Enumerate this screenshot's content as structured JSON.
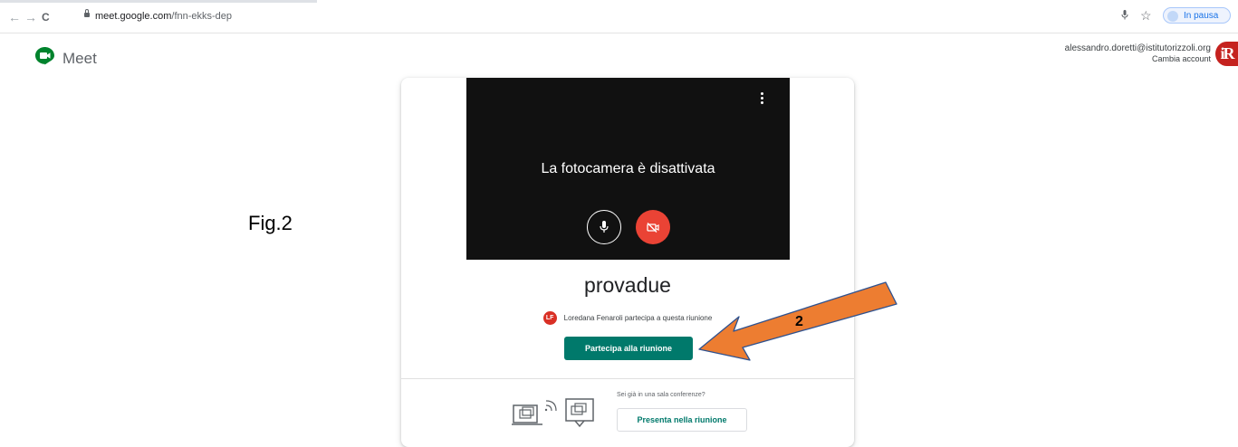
{
  "browser": {
    "nav_back": "←",
    "nav_forward": "→",
    "nav_reload": "C",
    "url_host": "meet.google.com",
    "url_path": "/fnn-ekks-dep",
    "pause_label": "In pausa",
    "icons": [
      "mic-icon",
      "star-icon",
      "kebab-menu-icon",
      "lock-icon"
    ]
  },
  "header": {
    "app_name": "Meet",
    "account_email": "alessandro.doretti@istitutorizzoli.org",
    "switch_account": "Cambia account",
    "avatar_initials": "iR"
  },
  "figure_label": "Fig.2",
  "preview": {
    "camera_status": "La fotocamera è disattivata",
    "icons": [
      "more-options-icon",
      "microphone-icon",
      "camera-off-icon"
    ]
  },
  "meeting": {
    "name": "provadue",
    "participant_initials": "LF",
    "participant_text": "Loredana Fenaroli partecipa a questa riunione",
    "join_button": "Partecipa alla riunione"
  },
  "conference": {
    "question": "Sei già in una sala conferenze?",
    "present_button": "Presenta nella riunione"
  },
  "annotation": {
    "number": "2",
    "arrow_color": "#ed7d31"
  },
  "colors": {
    "meet_green": "#00796b",
    "cam_off_red": "#ea4335",
    "avatar_red": "#c5221f"
  }
}
